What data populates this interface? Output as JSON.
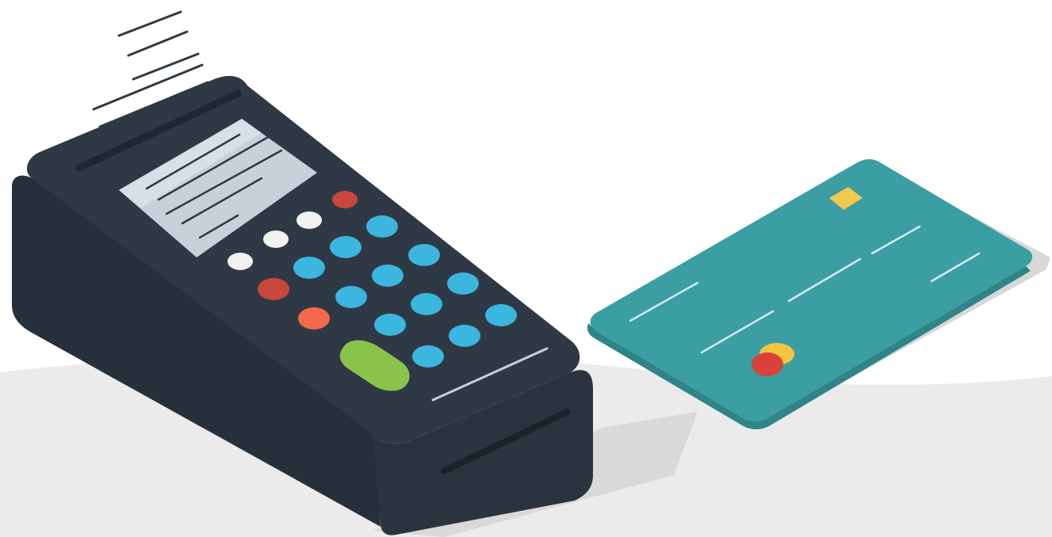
{
  "illustration": {
    "subject_items": [
      "payment-terminal",
      "credit-card",
      "printed-receipt"
    ],
    "colors": {
      "background": "#ffffff",
      "floor": "#ebebeb",
      "terminal_body": "#2f3945",
      "terminal_side": "#26303b",
      "screen": "#c7d1da",
      "key_blue": "#3bb6df",
      "key_white": "#f2f2f2",
      "key_red": "#c9473a",
      "key_orange": "#f26a4b",
      "key_green": "#8bc34a",
      "card": "#3a9ea3",
      "card_chip": "#f2c94c",
      "card_logo_red": "#d9413b",
      "card_logo_yellow": "#f4c542",
      "receipt": "#f7f7f7"
    }
  },
  "caption": {
    "partial_text": ""
  }
}
